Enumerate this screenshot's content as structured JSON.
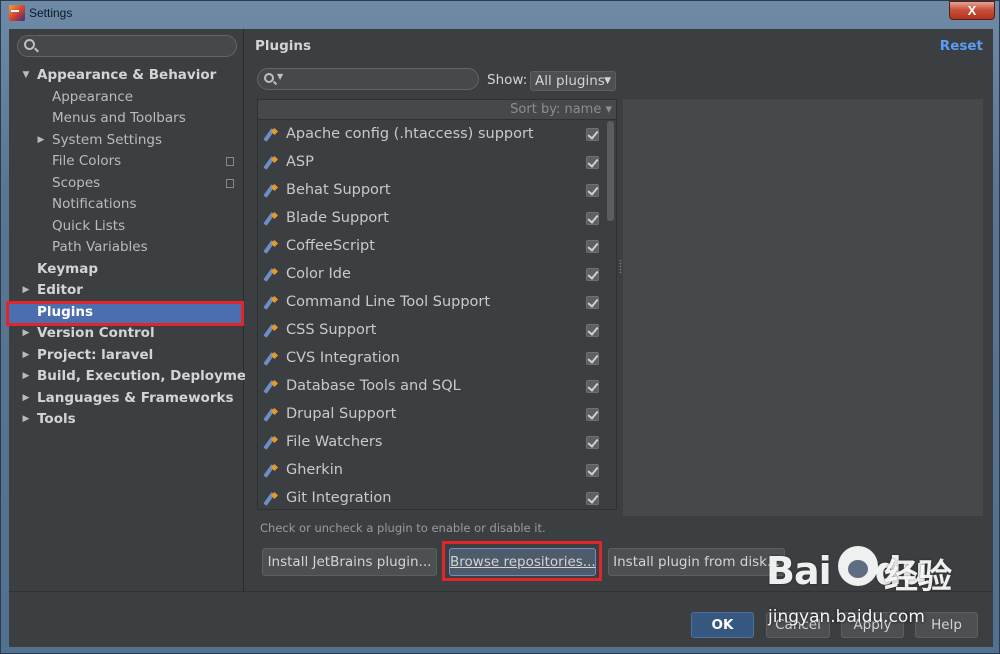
{
  "window": {
    "title": "Settings",
    "close_label": "X"
  },
  "sidebar": {
    "items": [
      {
        "label": "Appearance & Behavior",
        "level": 0,
        "arrow": "▼"
      },
      {
        "label": "Appearance",
        "level": 1,
        "arrow": ""
      },
      {
        "label": "Menus and Toolbars",
        "level": 1,
        "arrow": ""
      },
      {
        "label": "System Settings",
        "level": 1,
        "arrow": "▶"
      },
      {
        "label": "File Colors",
        "level": 1,
        "arrow": ""
      },
      {
        "label": "Scopes",
        "level": 1,
        "arrow": ""
      },
      {
        "label": "Notifications",
        "level": 1,
        "arrow": ""
      },
      {
        "label": "Quick Lists",
        "level": 1,
        "arrow": ""
      },
      {
        "label": "Path Variables",
        "level": 1,
        "arrow": ""
      },
      {
        "label": "Keymap",
        "level": 0,
        "arrow": ""
      },
      {
        "label": "Editor",
        "level": 0,
        "arrow": "▶"
      },
      {
        "label": "Plugins",
        "level": 0,
        "arrow": "",
        "selected": true
      },
      {
        "label": "Version Control",
        "level": 0,
        "arrow": "▶"
      },
      {
        "label": "Project: laravel",
        "level": 0,
        "arrow": "▶"
      },
      {
        "label": "Build, Execution, Deployment",
        "level": 0,
        "arrow": "▶"
      },
      {
        "label": "Languages & Frameworks",
        "level": 0,
        "arrow": "▶"
      },
      {
        "label": "Tools",
        "level": 0,
        "arrow": "▶"
      }
    ]
  },
  "main": {
    "title": "Plugins",
    "reset_label": "Reset",
    "show_label": "Show:",
    "show_value": "All plugins",
    "sort_label": "Sort by: name ▾",
    "plugins": [
      "Apache config (.htaccess) support",
      "ASP",
      "Behat Support",
      "Blade Support",
      "CoffeeScript",
      "Color Ide",
      "Command Line Tool Support",
      "CSS Support",
      "CVS Integration",
      "Database Tools and SQL",
      "Drupal Support",
      "File Watchers",
      "Gherkin",
      "Git Integration"
    ],
    "hint": "Check or uncheck a plugin to enable or disable it.",
    "buttons": {
      "install_jetbrains": "Install JetBrains plugin...",
      "browse_repositories": "Browse repositories...",
      "install_from_disk": "Install plugin from disk..."
    }
  },
  "footer": {
    "ok_label": "OK",
    "cancel_label": "Cancel",
    "apply_label": "Apply",
    "help_label": "Help"
  },
  "watermark": {
    "logo": "Bai",
    "logo_suffix": "du",
    "chinese": "经验",
    "url": "jingyan.baidu.com"
  },
  "colors": {
    "accent_selection": "#4b6eaf",
    "link": "#589df6",
    "highlight_red": "#e0262c",
    "panel_bg": "#3c3f41"
  }
}
